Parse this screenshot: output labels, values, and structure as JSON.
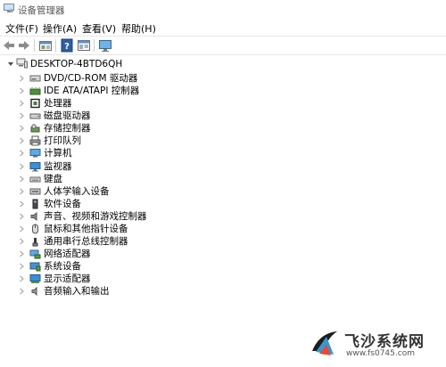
{
  "window": {
    "title": "设备管理器"
  },
  "menu": [
    "文件(F)",
    "操作(A)",
    "查看(V)",
    "帮助(H)"
  ],
  "toolbar": {
    "buttons": [
      "back-arrow-icon",
      "forward-arrow-icon",
      "properties-icon",
      "help-icon",
      "details-icon",
      "monitor-icon"
    ]
  },
  "tree": {
    "root": "DESKTOP-4BTD6QH",
    "items": [
      {
        "label": "DVD/CD-ROM 驱动器",
        "icon": "dvd-drive-icon"
      },
      {
        "label": "IDE ATA/ATAPI 控制器",
        "icon": "ide-controller-icon"
      },
      {
        "label": "处理器",
        "icon": "processor-icon"
      },
      {
        "label": "磁盘驱动器",
        "icon": "disk-drive-icon"
      },
      {
        "label": "存储控制器",
        "icon": "storage-controller-icon"
      },
      {
        "label": "打印队列",
        "icon": "printer-icon"
      },
      {
        "label": "计算机",
        "icon": "computer-icon"
      },
      {
        "label": "监视器",
        "icon": "monitor-icon"
      },
      {
        "label": "键盘",
        "icon": "keyboard-icon"
      },
      {
        "label": "人体学输入设备",
        "icon": "hid-icon"
      },
      {
        "label": "软件设备",
        "icon": "software-device-icon"
      },
      {
        "label": "声音、视频和游戏控制器",
        "icon": "sound-icon"
      },
      {
        "label": "鼠标和其他指针设备",
        "icon": "mouse-icon"
      },
      {
        "label": "通用串行总线控制器",
        "icon": "usb-icon"
      },
      {
        "label": "网络适配器",
        "icon": "network-adapter-icon"
      },
      {
        "label": "系统设备",
        "icon": "system-device-icon"
      },
      {
        "label": "显示适配器",
        "icon": "display-adapter-icon"
      },
      {
        "label": "音频输入和输出",
        "icon": "audio-io-icon"
      }
    ]
  },
  "watermark": {
    "brand": "飞沙系统网",
    "url": "www.fs0745.com"
  }
}
